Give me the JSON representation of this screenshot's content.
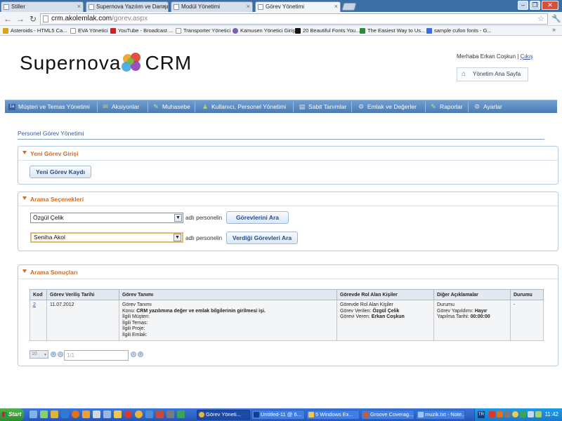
{
  "browser": {
    "tabs": [
      {
        "label": "Stiller",
        "active": false
      },
      {
        "label": "Supernova Yazılım ve Danışm",
        "active": false
      },
      {
        "label": "Modül Yönetimi",
        "active": false
      },
      {
        "label": "Görev Yönetimi",
        "active": true
      }
    ],
    "url_host": "crm.akolemlak.com",
    "url_path": "/gorev.aspx",
    "bookmarks": [
      {
        "label": "Asteroids - HTML5 Ca...",
        "color": "#d9a21b"
      },
      {
        "label": "EVA Yönetici",
        "color": "#ffffff"
      },
      {
        "label": "YouTube - Broadcast ...",
        "color": "#cc2222"
      },
      {
        "label": "Transporter Yönetici",
        "color": "#ffffff"
      },
      {
        "label": "Kamusen Yönetici Girişi",
        "color": "#7a5bb5"
      },
      {
        "label": "20 Beautiful Fonts You...",
        "color": "#111111"
      },
      {
        "label": "The Easiest Way to Us...",
        "color": "#2e8b3e"
      },
      {
        "label": "sample cufon fonts - G...",
        "color": "#3a6ee0"
      }
    ]
  },
  "header": {
    "logo_text": "Supernova",
    "logo_suffix": "CRM",
    "greeting": "Merhaba Erkan Coşkun |",
    "logout": "Çıkış",
    "home_button": "Yönetim Ana Sayfa"
  },
  "menu": [
    {
      "label": "Müşteri ve Temas Yönetimi",
      "icon": "contacts-icon"
    },
    {
      "label": "Aksiyonlar",
      "icon": "actions-icon"
    },
    {
      "label": "Muhasebe",
      "icon": "accounting-icon"
    },
    {
      "label": "Kullanıcı, Personel Yönetimi",
      "icon": "users-icon"
    },
    {
      "label": "Sabit Tanımlar",
      "icon": "definitions-icon"
    },
    {
      "label": "Emlak ve Değerler",
      "icon": "realestate-icon"
    },
    {
      "label": "Raporlar",
      "icon": "reports-icon"
    },
    {
      "label": "Ayarlar",
      "icon": "settings-icon"
    }
  ],
  "page": {
    "title": "Personel Görev Yönetimi"
  },
  "new_task": {
    "title": "Yeni Görev Girişi",
    "button": "Yeni Görev Kaydı"
  },
  "search": {
    "title": "Arama Seçenekleri",
    "row1": {
      "selected": "Özgül Çelik",
      "label": "adlı personelin",
      "button": "Görevlerini Ara"
    },
    "row2": {
      "selected": "Seniha Akol",
      "label": "adlı personelin",
      "button": "Verdiği Görevleri Ara"
    }
  },
  "results": {
    "title": "Arama Sonuçları",
    "headers": [
      "Kod",
      "Görev Veriliş Tarihi",
      "Görev Tanımı",
      "Görevde Rol Alan Kişiler",
      "Diğer Açıklamalar",
      "Durumu"
    ],
    "rows": [
      {
        "kod": "2",
        "date": "11.07.2012",
        "desc_title": "Görev Tanımı",
        "konu_label": "Konu:",
        "konu_value": "CRM yazılımına değer ve emlak bilgilerinin girilmesi işi.",
        "musteri": "İlgili Müşteri:",
        "temas": "İlgili Temas:",
        "proje": "İlgili Proje:",
        "emlak": "İlgili Emlak:",
        "roles_title": "Görevde Rol Alan Kişiler",
        "verilen_label": "Görev Verilen:",
        "verilen_value": "Özgül Çelik",
        "veren_label": "Görevi Veren:",
        "veren_value": "Erkan Coşkun",
        "status_title": "Durumu",
        "yapildi_label": "Görev Yapıldımı:",
        "yapildi_value": "Hayır",
        "tarih_label": "Yapılma Tarihi:",
        "tarih_value": "00:00:00",
        "durum": "-"
      }
    ]
  },
  "pager": {
    "page_size": "10",
    "page_info": "1/1"
  },
  "taskbar": {
    "start": "Start",
    "tasks": [
      {
        "label": "Görev Yöneti...",
        "color": "#e9b33a",
        "active": true
      },
      {
        "label": "Untitled-11 @ 6...",
        "color": "#1a3a8a",
        "active": false
      },
      {
        "label": "5 Windows Ex...",
        "color": "#f2c94c",
        "active": false
      },
      {
        "label": "Groove Coverag...",
        "color": "#d35a1a",
        "active": false
      },
      {
        "label": "muzik.txt - Note...",
        "color": "#9ec6ef",
        "active": false
      }
    ],
    "language": "TR",
    "clock": "11:42"
  }
}
